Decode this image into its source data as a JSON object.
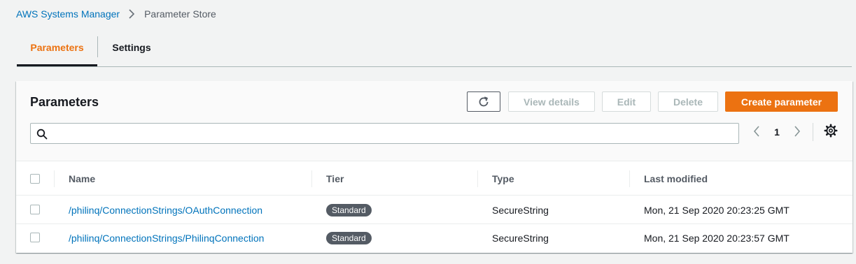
{
  "breadcrumb": {
    "parent": "AWS Systems Manager",
    "current": "Parameter Store"
  },
  "tabs": [
    {
      "label": "Parameters",
      "active": true
    },
    {
      "label": "Settings",
      "active": false
    }
  ],
  "panel": {
    "title": "Parameters",
    "buttons": {
      "view_details": "View details",
      "edit": "Edit",
      "delete": "Delete",
      "create": "Create parameter"
    },
    "search": {
      "value": "",
      "placeholder": ""
    },
    "pager": {
      "page": "1"
    }
  },
  "table": {
    "columns": [
      "Name",
      "Tier",
      "Type",
      "Last modified"
    ],
    "rows": [
      {
        "name": "/philinq/ConnectionStrings/OAuthConnection",
        "tier": "Standard",
        "type": "SecureString",
        "last_modified": "Mon, 21 Sep 2020 20:23:25 GMT"
      },
      {
        "name": "/philinq/ConnectionStrings/PhilinqConnection",
        "tier": "Standard",
        "type": "SecureString",
        "last_modified": "Mon, 21 Sep 2020 20:23:57 GMT"
      }
    ]
  },
  "colors": {
    "accent": "#ec7211",
    "link": "#0073bb",
    "badge": "#545b64"
  },
  "icons": {
    "breadcrumb_separator": "chevron-right-icon",
    "refresh": "refresh-icon",
    "search": "search-icon",
    "pager_prev": "chevron-left-icon",
    "pager_next": "chevron-right-icon",
    "settings": "gear-icon"
  }
}
